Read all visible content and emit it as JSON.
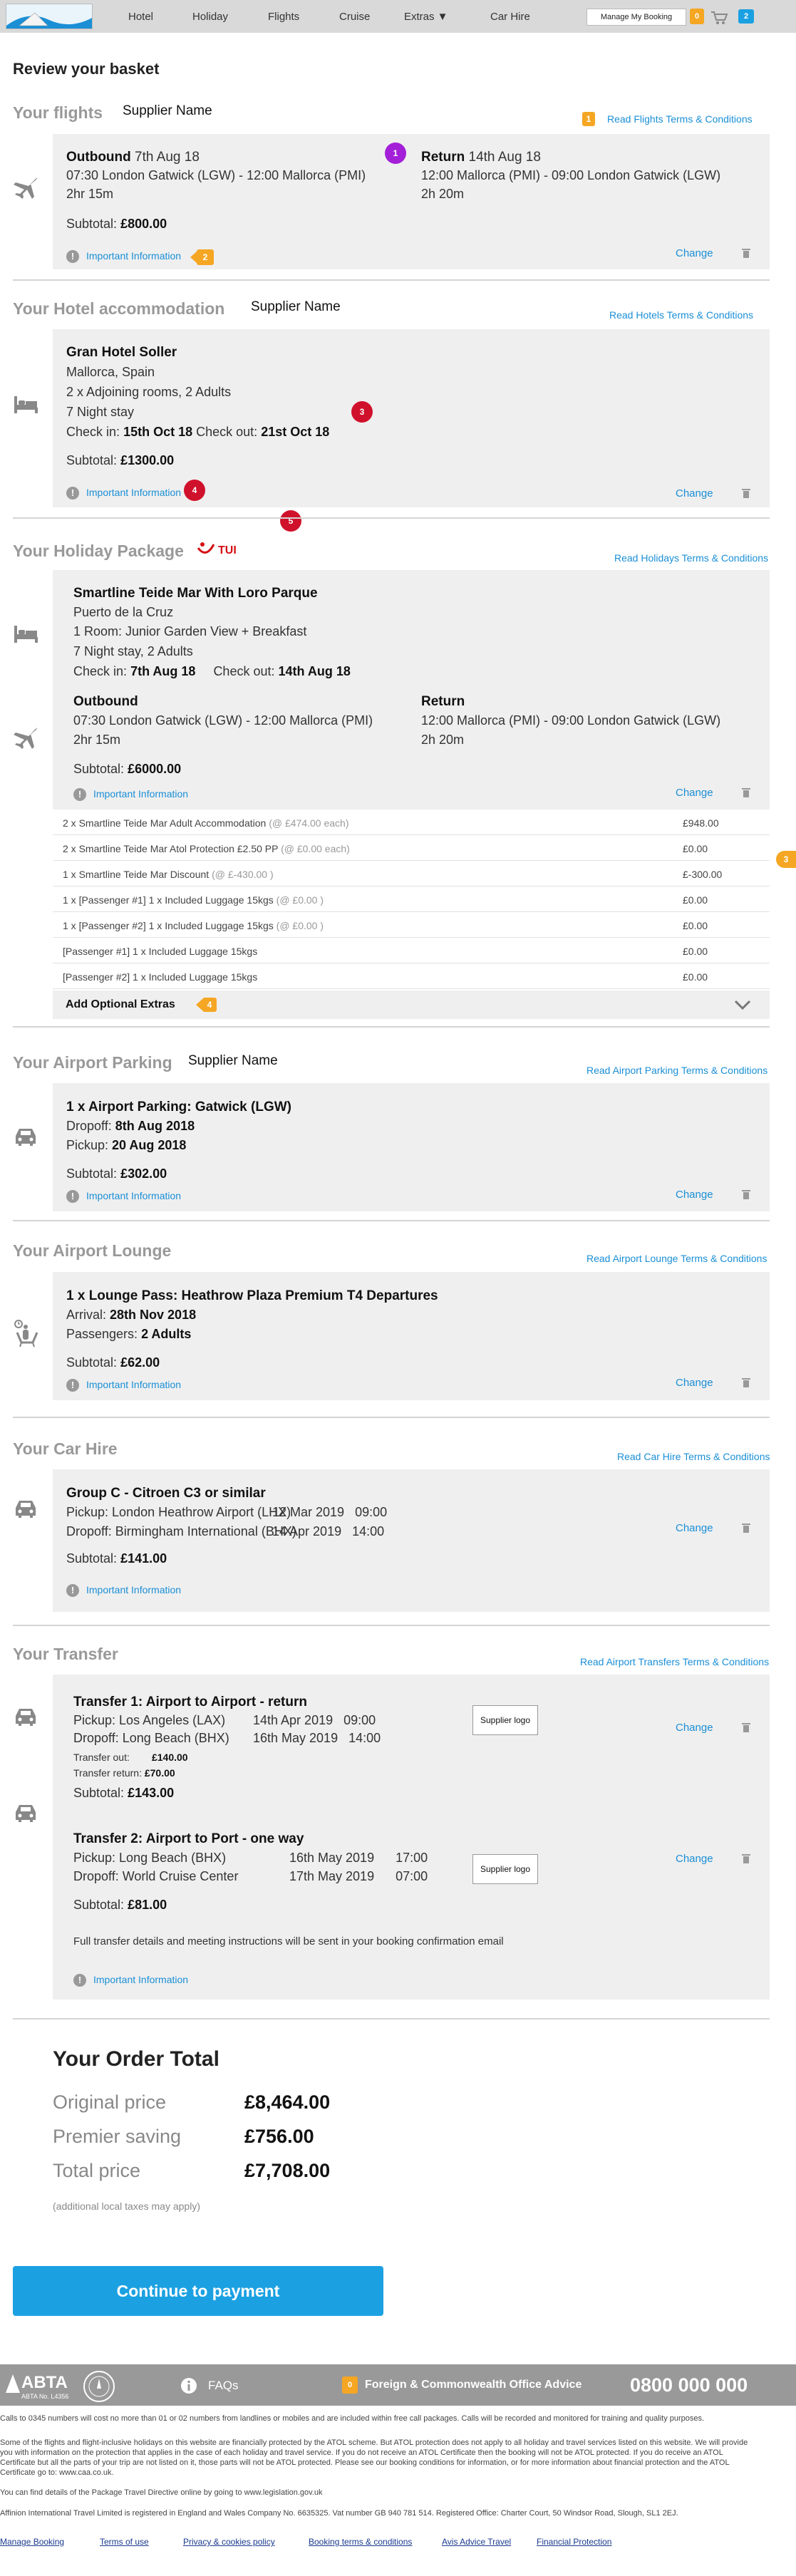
{
  "nav": {
    "items": [
      "Hotel",
      "Holiday",
      "Flights",
      "Cruise",
      "Extras ▼",
      "Car Hire"
    ],
    "my_booking": "Manage My Booking",
    "count_orange": "0",
    "count_blue": "2"
  },
  "page_title": "Review your basket",
  "supplier_label": "Supplier Name",
  "change_label": "Change",
  "important_info": "Important Information",
  "flights": {
    "title": "Your flights",
    "terms": "Read Flights Terms & Conditions",
    "terms_badge": "1",
    "outbound_label": "Outbound",
    "outbound_date": "7th Aug 18",
    "outbound_route": "07:30 London Gatwick (LGW) - 12:00 Mallorca (PMI)",
    "outbound_duration": "2hr 15m",
    "return_label": "Return",
    "return_date": "14th Aug 18",
    "return_route": "12:00 Mallorca (PMI) - 09:00 London Gatwick (LGW)",
    "return_duration": "2h 20m",
    "subtotal_label": "Subtotal:",
    "subtotal": "£800.00",
    "pin": "1",
    "info_badge": "2"
  },
  "hotel": {
    "title": "Your Hotel accommodation",
    "terms": "Read Hotels Terms & Conditions",
    "name": "Gran Hotel Soller",
    "location": "Mallorca, Spain",
    "rooms": "2 x Adjoining rooms, 2 Adults",
    "stay": "7 Night stay",
    "checkin_label": "Check in:",
    "checkin": "15th Oct 18",
    "checkout_label": "Check out:",
    "checkout": "21st Oct 18",
    "subtotal_label": "Subtotal:",
    "subtotal": "£1300.00",
    "pin3": "3",
    "pin4": "4",
    "pin5": "5"
  },
  "package": {
    "title": "Your Holiday Package",
    "brand": "TUI",
    "terms": "Read Holidays Terms & Conditions",
    "name": "Smartline Teide Mar With Loro Parque",
    "location": "Puerto de la Cruz",
    "room": "1 Room: Junior Garden View + Breakfast",
    "stay": "7 Night stay, 2 Adults",
    "checkin_label": "Check in:",
    "checkin": "7th Aug 18",
    "checkout_label": "Check out:",
    "checkout": "14th Aug 18",
    "outbound_label": "Outbound",
    "outbound_route": "07:30 London Gatwick (LGW) - 12:00 Mallorca (PMI)",
    "outbound_duration": "2hr 15m",
    "return_label": "Return",
    "return_route": "12:00 Mallorca (PMI) - 09:00 London Gatwick (LGW)",
    "return_duration": "2h 20m",
    "subtotal_label": "Subtotal:",
    "subtotal": "£6000.00",
    "side_badge": "3",
    "lines": [
      {
        "desc": "2 x Smartline Teide Mar Adult Accommodation",
        "note": "(@ £474.00 each)",
        "price": "£948.00"
      },
      {
        "desc": "2 x Smartline Teide Mar Atol Protection £2.50 PP",
        "note": "(@ £0.00 each)",
        "price": "£0.00"
      },
      {
        "desc": "1 x Smartline Teide Mar Discount",
        "note": "(@ £-430.00 )",
        "price": "£-300.00"
      },
      {
        "desc": "1 x [Passenger #1] 1 x Included Luggage 15kgs",
        "note": "(@ £0.00 )",
        "price": "£0.00"
      },
      {
        "desc": "1 x [Passenger #2] 1 x Included Luggage 15kgs",
        "note": "(@ £0.00 )",
        "price": "£0.00"
      },
      {
        "desc": "[Passenger #1] 1 x Included Luggage 15kgs",
        "note": "",
        "price": "£0.00"
      },
      {
        "desc": "[Passenger #2] 1 x Included Luggage 15kgs",
        "note": "",
        "price": "£0.00"
      }
    ],
    "extras_label": "Add Optional Extras",
    "extras_badge": "4"
  },
  "parking": {
    "title": "Your Airport Parking",
    "terms": "Read Airport Parking Terms & Conditions",
    "name": "1 x Airport Parking: Gatwick (LGW)",
    "dropoff_label": "Dropoff:",
    "dropoff": "8th Aug 2018",
    "pickup_label": "Pickup:",
    "pickup": "20 Aug 2018",
    "subtotal_label": "Subtotal:",
    "subtotal": "£302.00"
  },
  "lounge": {
    "title": "Your Airport Lounge",
    "terms": "Read Airport Lounge Terms & Conditions",
    "name": "1 x Lounge Pass: Heathrow Plaza Premium T4 Departures",
    "arrival_label": "Arrival:",
    "arrival": "28th Nov 2018",
    "passengers_label": "Passengers:",
    "passengers": "2 Adults",
    "subtotal_label": "Subtotal:",
    "subtotal": "£62.00"
  },
  "carhire": {
    "title": "Your Car Hire",
    "terms": "Read Car Hire Terms & Conditions",
    "name": "Group C - Citroen C3 or similar",
    "pickup_label": "Pickup:",
    "pickup_place": "London Heathrow Airport (LHX)",
    "pickup_date": "12 Mar 2019",
    "pickup_time": "09:00",
    "dropoff_label": "Dropoff:",
    "dropoff_place": "Birmingham International (BHX)",
    "dropoff_date": "14 Apr 2019",
    "dropoff_time": "14:00",
    "subtotal_label": "Subtotal:",
    "subtotal": "£141.00"
  },
  "transfer": {
    "title": "Your Transfer",
    "terms": "Read Airport Transfers Terms & Conditions",
    "supplier_logo": "Supplier logo",
    "t1_name": "Transfer 1: Airport to Airport - return",
    "t1_pickup_label": "Pickup:",
    "t1_pickup_place": "Los Angeles (LAX)",
    "t1_pickup_date": "14th Apr 2019",
    "t1_pickup_time": "09:00",
    "t1_dropoff_label": "Dropoff:",
    "t1_dropoff_place": "Long Beach (BHX)",
    "t1_dropoff_date": "16th May 2019",
    "t1_dropoff_time": "14:00",
    "t1_out_label": "Transfer out:",
    "t1_out": "£140.00",
    "t1_ret_label": "Transfer return:",
    "t1_ret": "£70.00",
    "t1_subtotal_label": "Subtotal:",
    "t1_subtotal": "£143.00",
    "t2_name": "Transfer 2: Airport to Port - one way",
    "t2_pickup_label": "Pickup:",
    "t2_pickup_place": "Long Beach (BHX)",
    "t2_pickup_date": "16th May 2019",
    "t2_pickup_time": "17:00",
    "t2_dropoff_label": "Dropoff:",
    "t2_dropoff_place": "World Cruise Center",
    "t2_dropoff_date": "17th May 2019",
    "t2_dropoff_time": "07:00",
    "t2_subtotal_label": "Subtotal:",
    "t2_subtotal": "£81.00",
    "note": "Full transfer details and meeting instructions will be sent in your booking confirmation email"
  },
  "order": {
    "title": "Your Order Total",
    "original_label": "Original price",
    "original": "£8,464.00",
    "saving_label": "Premier saving",
    "saving": "£756.00",
    "total_label": "Total price",
    "total": "£7,708.00",
    "tax_note": "(additional local taxes may apply)"
  },
  "cta": "Continue to payment",
  "footer": {
    "abta": "ABTA",
    "abta_no": "ABTA No. L4356",
    "faqs": "FAQs",
    "fco_badge": "0",
    "fco": "Foreign & Commonwealth Office Advice",
    "phone": "0800 000 000",
    "line1": "Calls to 0345 numbers will cost no more than 01 or 02 numbers from landlines or mobiles and are included within free call packages. Calls will be recorded and monitored for training and quality purposes.",
    "line2": "Some of the flights and flight-inclusive holidays on this website are financially protected by the ATOL scheme. But ATOL protection does not apply to all holiday and travel services listed on this website. We will provide you with information on the protection that applies in the case of each holiday and travel service. If you do not receive an ATOL Certificate then the booking will not be ATOL protected. If you do receive an ATOL Certificate but all the parts of your trip are not listed on it, those parts will not be ATOL protected. Please see our booking conditions for information, or for more information about financial protection and the ATOL Certificate go to: www.caa.co.uk.",
    "line3": "You can find details of the Package Travel Directive online by going to www.legislation.gov.uk",
    "line4": "Affinion International Travel Limited is registered in England and Wales Company No. 6635325. Vat number GB 940 781 514. Registered Office: Charter Court, 50 Windsor Road, Slough, SL1 2EJ.",
    "links": [
      "Manage Booking",
      "Terms of use",
      "Privacy & cookies policy",
      "Booking terms & conditions",
      "Avis Advice Travel",
      "Financial Protection"
    ]
  }
}
